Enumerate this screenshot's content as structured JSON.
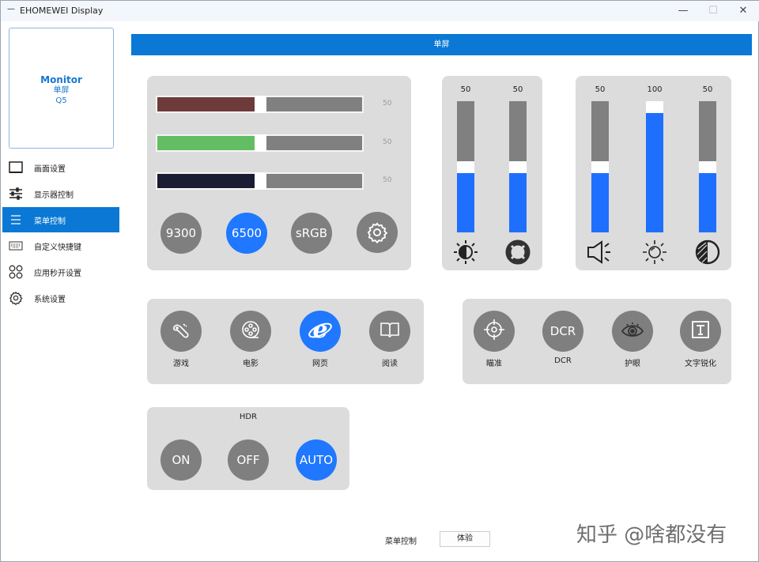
{
  "window": {
    "title": "EHOMEWEI Display",
    "minimize": "—",
    "maximize": "☐",
    "close": "✕"
  },
  "device": {
    "name": "Monitor",
    "mode": "单屏",
    "model": "Q5"
  },
  "sidebar": {
    "items": [
      {
        "label": "画面设置",
        "icon": "monitor-icon"
      },
      {
        "label": "显示器控制",
        "icon": "sliders-icon"
      },
      {
        "label": "菜单控制",
        "icon": "menu-icon",
        "active": true
      },
      {
        "label": "自定义快捷键",
        "icon": "keyboard-icon"
      },
      {
        "label": "应用秒开设置",
        "icon": "apps-icon"
      },
      {
        "label": "系统设置",
        "icon": "gear-icon"
      }
    ]
  },
  "header": {
    "title": "单屏"
  },
  "color": {
    "sliders": [
      {
        "name": "red",
        "value": 50,
        "color": "#6e3a3a"
      },
      {
        "name": "green",
        "value": 50,
        "color": "#62bd63"
      },
      {
        "name": "blue",
        "value": 50,
        "color": "#1b1b33"
      }
    ],
    "presets": [
      {
        "label": "9300"
      },
      {
        "label": "6500",
        "active": true
      },
      {
        "label": "sRGB"
      }
    ]
  },
  "picture": {
    "sliders": [
      {
        "name": "brightness",
        "value": 50,
        "icon": "brightness-contrast-icon"
      },
      {
        "name": "contrast",
        "value": 50,
        "icon": "lifebuoy-icon"
      }
    ]
  },
  "audio": {
    "sliders": [
      {
        "name": "volume",
        "value": 50,
        "icon": "speaker-icon"
      },
      {
        "name": "backlight",
        "value": 100,
        "icon": "sun-icon"
      },
      {
        "name": "gamma",
        "value": 50,
        "icon": "contrast-icon"
      }
    ]
  },
  "modes": [
    {
      "label": "游戏",
      "icon": "gamepad-icon"
    },
    {
      "label": "电影",
      "icon": "film-reel-icon"
    },
    {
      "label": "网页",
      "icon": "ie-browser-icon",
      "active": true
    },
    {
      "label": "阅读",
      "icon": "book-icon"
    }
  ],
  "features": [
    {
      "label": "瞄准",
      "icon": "crosshair-icon"
    },
    {
      "label": "DCR",
      "text": "DCR",
      "icon": "dcr-icon"
    },
    {
      "label": "护眼",
      "icon": "eye-icon"
    },
    {
      "label": "文字锐化",
      "icon": "text-sharpen-icon"
    }
  ],
  "hdr": {
    "title": "HDR",
    "options": [
      {
        "label": "ON"
      },
      {
        "label": "OFF"
      },
      {
        "label": "AUTO",
        "active": true
      }
    ]
  },
  "footer": {
    "section": "菜单控制",
    "button": "体验"
  },
  "watermark": "知乎 @啥都没有",
  "colors": {
    "accent": "#0a78d4",
    "active": "#1f78ff",
    "inactive": "#7f7f7f",
    "panel": "#dcdcdc"
  }
}
